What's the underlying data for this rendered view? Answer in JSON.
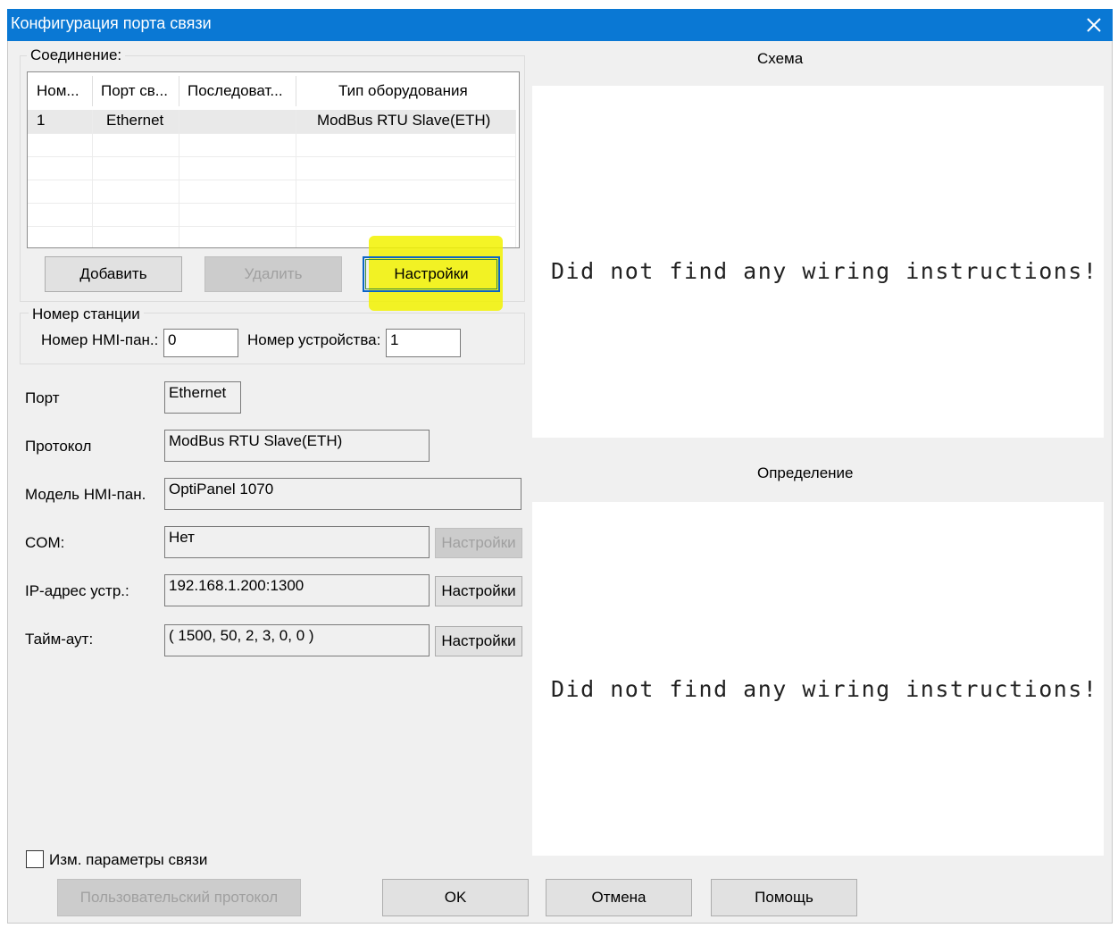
{
  "window": {
    "title": "Конфигурация порта связи",
    "close_icon": "close-icon"
  },
  "connection": {
    "legend": "Соединение:",
    "columns": [
      "Ном...",
      "Порт св...",
      "Последоват...",
      "Тип оборудования"
    ],
    "rows": [
      {
        "num": "1",
        "port": "Ethernet",
        "seq": "",
        "type": "ModBus RTU Slave(ETH)"
      }
    ],
    "buttons": {
      "add": "Добавить",
      "delete": "Удалить",
      "settings": "Настройки"
    },
    "highlight_color": "#f2f200"
  },
  "station": {
    "legend": "Номер станции",
    "hmi_label": "Номер HMI-пан.:",
    "hmi_value": "0",
    "device_label": "Номер устройства:",
    "device_value": "1"
  },
  "fields": {
    "port_label": "Порт",
    "port_value": "Ethernet",
    "protocol_label": "Протокол",
    "protocol_value": "ModBus RTU Slave(ETH)",
    "model_label": "Модель HMI-пан.",
    "model_value": "OptiPanel 1070",
    "com_label": "COM:",
    "com_value": "Нет",
    "com_button": "Настройки",
    "ip_label": "IP-адрес устр.:",
    "ip_value": "192.168.1.200:1300",
    "ip_button": "Настройки",
    "timeout_label": "Тайм-аут:",
    "timeout_value": "( 1500, 50, 2, 3, 0, 0 )",
    "timeout_button": "Настройки"
  },
  "right": {
    "scheme_title": "Схема",
    "scheme_text": "Did not find any wiring instructions!",
    "definition_title": "Определение",
    "definition_text": "Did not find any wiring instructions!"
  },
  "bottom": {
    "checkbox_label": "Изм. параметры связи",
    "checkbox_checked": false,
    "custom_protocol": "Пользовательский протокол",
    "ok": "OK",
    "cancel": "Отмена",
    "help": "Помощь"
  },
  "colors": {
    "titlebar": "#0a78d4",
    "accent_border": "#0a64c8"
  }
}
